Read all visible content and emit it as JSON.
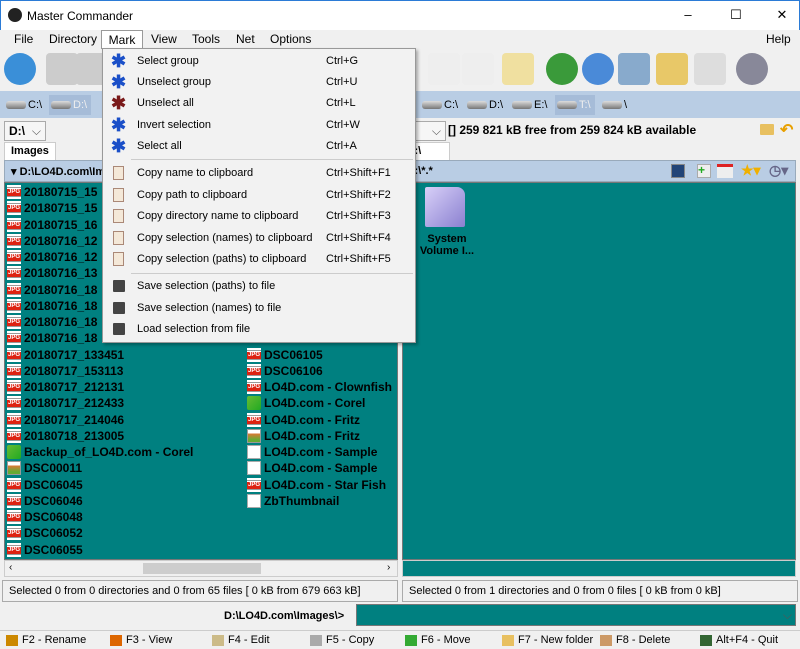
{
  "window": {
    "title": "Master Commander",
    "minimize": "–",
    "maximize": "☐",
    "close": "✕"
  },
  "menubar": {
    "items": [
      "File",
      "Directory",
      "Mark",
      "View",
      "Tools",
      "Net",
      "Options"
    ],
    "help": "Help"
  },
  "toolbar": {
    "icons": [
      "refresh-icon",
      "panel-view-icon",
      "thumbnail-view-icon",
      "search-icon",
      "notepad-icon",
      "edit-icon",
      "download-globe-icon",
      "network-globe-icon",
      "ftp-icon",
      "sync-folders-icon",
      "compare-icon",
      "settings-gear-icon"
    ]
  },
  "left": {
    "drives": [
      "C:\\",
      "D:\\"
    ],
    "active_drive": "D:\\",
    "combo": "D:\\",
    "tab": "Images",
    "path": "D:\\LO4D.com\\Im",
    "files_col1": [
      {
        "name": "20180715_15",
        "type": "jpg"
      },
      {
        "name": "20180715_15",
        "type": "jpg"
      },
      {
        "name": "20180715_16",
        "type": "jpg"
      },
      {
        "name": "20180716_12",
        "type": "jpg"
      },
      {
        "name": "20180716_12",
        "type": "jpg"
      },
      {
        "name": "20180716_13",
        "type": "jpg"
      },
      {
        "name": "20180716_18",
        "type": "jpg"
      },
      {
        "name": "20180716_18",
        "type": "jpg"
      },
      {
        "name": "20180716_18",
        "type": "jpg"
      },
      {
        "name": "20180716_18",
        "type": "jpg"
      },
      {
        "name": "20180717_133451",
        "type": "jpg"
      },
      {
        "name": "20180717_153113",
        "type": "jpg"
      },
      {
        "name": "20180717_212131",
        "type": "jpg"
      },
      {
        "name": "20180717_212433",
        "type": "jpg"
      },
      {
        "name": "20180717_214046",
        "type": "jpg"
      },
      {
        "name": "20180718_213005",
        "type": "jpg"
      },
      {
        "name": "Backup_of_LO4D.com - Corel",
        "type": "corel"
      },
      {
        "name": "DSC00011",
        "type": "img"
      },
      {
        "name": "DSC06045",
        "type": "jpg"
      },
      {
        "name": "DSC06046",
        "type": "jpg"
      },
      {
        "name": "DSC06048",
        "type": "jpg"
      },
      {
        "name": "DSC06052",
        "type": "jpg"
      },
      {
        "name": "DSC06055",
        "type": "jpg"
      }
    ],
    "files_col2": [
      {
        "name": "DSC06105",
        "type": "jpg"
      },
      {
        "name": "DSC06106",
        "type": "jpg"
      },
      {
        "name": "LO4D.com - Clownfish",
        "type": "jpg"
      },
      {
        "name": "LO4D.com - Corel",
        "type": "corel"
      },
      {
        "name": "LO4D.com - Fritz",
        "type": "jpg"
      },
      {
        "name": "LO4D.com - Fritz",
        "type": "img"
      },
      {
        "name": "LO4D.com - Sample",
        "type": "blank"
      },
      {
        "name": "LO4D.com - Sample",
        "type": "blank"
      },
      {
        "name": "LO4D.com - Star Fish",
        "type": "jpg"
      },
      {
        "name": "ZbThumbnail",
        "type": "blank"
      }
    ],
    "status": "Selected 0 from 0 directories and 0 from 65 files [ 0 kB from 679 663 kB]"
  },
  "right": {
    "drives": [
      "C:\\",
      "D:\\",
      "E:\\",
      "T:\\",
      "\\"
    ],
    "active_drive": "T:\\",
    "combo": ":\\",
    "free_space": "[] 259 821 kB free from 259 824 kB available",
    "tab": "T:\\",
    "path": "T:\\*.*",
    "folder": "System Volume I...",
    "status": "Selected 0 from 1 directories and 0 from 0 files [ 0 kB from 0 kB]"
  },
  "command": {
    "prompt": "D:\\LO4D.com\\Images\\>",
    "value": ""
  },
  "fkeys": [
    "F2 - Rename",
    "F3 - View",
    "F4 - Edit",
    "F5 - Copy",
    "F6 - Move",
    "F7 - New folder",
    "F8 - Delete",
    "Alt+F4 - Quit"
  ],
  "mark_menu": {
    "items": [
      {
        "label": "Select group",
        "shortcut": "Ctrl+G",
        "icon": "select-group-icon"
      },
      {
        "label": "Unselect group",
        "shortcut": "Ctrl+U",
        "icon": "unselect-group-icon"
      },
      {
        "label": "Unselect all",
        "shortcut": "Ctrl+L",
        "icon": "unselect-all-icon"
      },
      {
        "label": "Invert selection",
        "shortcut": "Ctrl+W",
        "icon": "invert-selection-icon"
      },
      {
        "label": "Select all",
        "shortcut": "Ctrl+A",
        "icon": "select-all-icon"
      },
      {
        "label": "Copy name to clipboard",
        "shortcut": "Ctrl+Shift+F1",
        "icon": "clipboard-icon"
      },
      {
        "label": "Copy path to clipboard",
        "shortcut": "Ctrl+Shift+F2",
        "icon": "clipboard-icon"
      },
      {
        "label": "Copy directory name to clipboard",
        "shortcut": "Ctrl+Shift+F3",
        "icon": "clipboard-icon"
      },
      {
        "label": "Copy selection (names) to clipboard",
        "shortcut": "Ctrl+Shift+F4",
        "icon": "clipboard-icon"
      },
      {
        "label": "Copy selection (paths) to clipboard",
        "shortcut": "Ctrl+Shift+F5",
        "icon": "clipboard-icon"
      },
      {
        "label": "Save selection (paths) to file",
        "shortcut": "",
        "icon": "floppy-disk-icon"
      },
      {
        "label": "Save selection (names) to file",
        "shortcut": "",
        "icon": "floppy-disk-icon"
      },
      {
        "label": "Load selection from file",
        "shortcut": "",
        "icon": "floppy-disk-icon"
      }
    ]
  },
  "colors": {
    "panel_bg": "#008080",
    "path_bar": "#b9cde4",
    "jpg_badge": "#dd2211"
  }
}
